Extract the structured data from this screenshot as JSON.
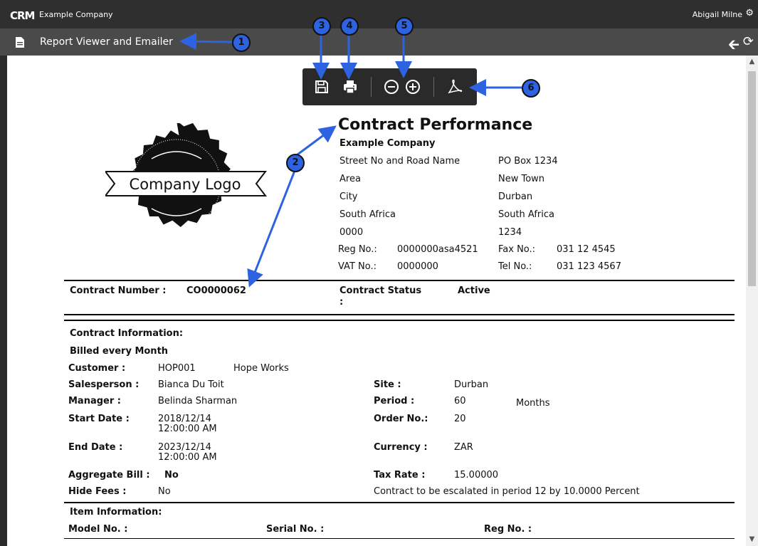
{
  "app": {
    "brand": "CRM",
    "company": "Example Company",
    "user": "Abigail Milne",
    "page_title": "Report Viewer and Emailer"
  },
  "callouts": [
    "1",
    "2",
    "3",
    "4",
    "5",
    "6"
  ],
  "logo": {
    "text": "Company Logo"
  },
  "report": {
    "title": "Contract Performance",
    "company_name": "Example Company",
    "address_left": [
      "Street No and Road Name",
      "Area",
      "City",
      "South Africa",
      "0000"
    ],
    "address_right": [
      "PO Box 1234",
      "New Town",
      "Durban",
      "South Africa",
      "1234"
    ],
    "reg_label": "Reg No.:",
    "reg_value": "0000000asa4521",
    "fax_label": "Fax No.:",
    "fax_value": "031 12 4545",
    "vat_label": "VAT No.:",
    "vat_value": "0000000",
    "tel_label": "Tel No.:",
    "tel_value": "031 123 4567",
    "contract_number_label": "Contract Number :",
    "contract_number_value": "CO0000062",
    "contract_status_label": "Contract Status",
    "contract_status_colon": ":",
    "contract_status_value": "Active",
    "section_contract_info": "Contract Information:",
    "billed": "Billed every Month",
    "customer_label": "Customer :",
    "customer_code": "HOP001",
    "customer_name": "Hope Works",
    "salesperson_label": "Salesperson :",
    "salesperson_value": "Bianca Du Toit",
    "site_label": "Site :",
    "site_value": "Durban",
    "manager_label": "Manager :",
    "manager_value": "Belinda Sharman",
    "period_label": "Period :",
    "period_value": "60",
    "period_unit": "Months",
    "start_label": "Start Date :",
    "start_date": "2018/12/14",
    "start_time": "12:00:00 AM",
    "order_label": "Order No.:",
    "order_value": "20",
    "end_label": "End Date :",
    "end_date": "2023/12/14",
    "end_time": "12:00:00 AM",
    "currency_label": "Currency :",
    "currency_value": "ZAR",
    "aggregate_label": "Aggregate Bill :",
    "aggregate_value": "No",
    "tax_label": "Tax Rate :",
    "tax_value": "15.00000",
    "hide_fees_label": "Hide Fees :",
    "hide_fees_value": "No",
    "escalation_note": "Contract to be escalated in period 12 by 10.0000 Percent",
    "section_item_info": "Item Information:",
    "col_model": "Model No. :",
    "col_serial": "Serial No. :",
    "col_reg": "Reg No. :"
  },
  "colors": {
    "callout": "#2d62e0",
    "topbar": "#2f2f2f",
    "subbar": "#4a4a4a",
    "toolbar": "#2a2a2a"
  }
}
